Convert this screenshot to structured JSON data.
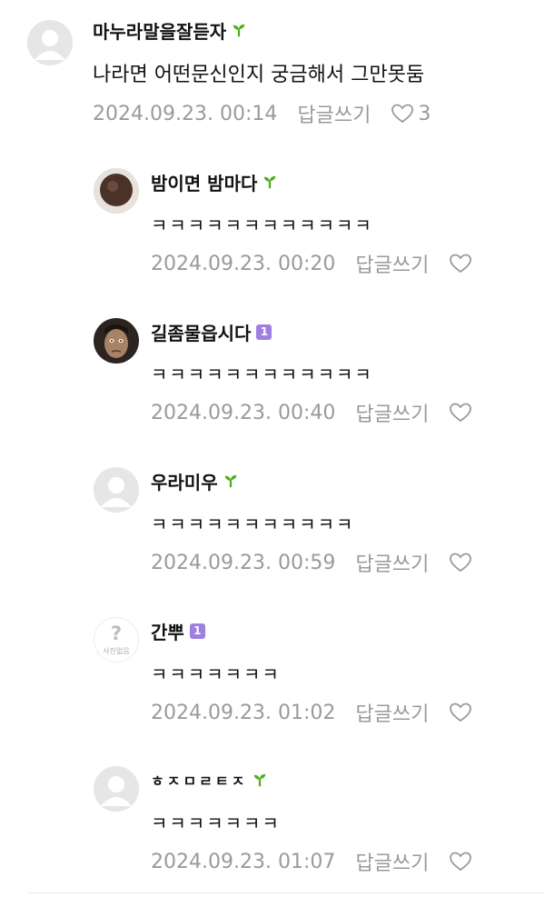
{
  "comments": [
    {
      "name": "마누라말을잘듣자",
      "badge": "sprout",
      "text": "나라면 어떤문신인지 궁금해서 그만못둠",
      "date": "2024.09.23. 00:14",
      "reply": "답글쓰기",
      "likes": "3",
      "avatar": "default-avatar"
    },
    {
      "name": "밤이면 밤마다",
      "badge": "sprout",
      "text": "ㅋㅋㅋㅋㅋㅋㅋㅋㅋㅋㅋㅋ",
      "date": "2024.09.23. 00:20",
      "reply": "답글쓰기",
      "avatar": "photo-avatar"
    },
    {
      "name": "길좀물읍시다",
      "badge": "level",
      "badge_text": "1",
      "text": "ㅋㅋㅋㅋㅋㅋㅋㅋㅋㅋㅋㅋ",
      "date": "2024.09.23. 00:40",
      "reply": "답글쓰기",
      "avatar": "face-photo-avatar"
    },
    {
      "name": "우라미우",
      "badge": "sprout",
      "text": "ㅋㅋㅋㅋㅋㅋㅋㅋㅋㅋㅋ",
      "date": "2024.09.23. 00:59",
      "reply": "답글쓰기",
      "avatar": "default-avatar"
    },
    {
      "name": "간뿌",
      "badge": "level",
      "badge_text": "1",
      "text": "ㅋㅋㅋㅋㅋㅋㅋ",
      "date": "2024.09.23. 01:02",
      "reply": "답글쓰기",
      "avatar": "no-photo-avatar",
      "avatar_caption": "사진없음"
    },
    {
      "name": "ㅎㅈㅁㄹㅌㅈ",
      "badge": "sprout",
      "text": "ㅋㅋㅋㅋㅋㅋㅋ",
      "date": "2024.09.23. 01:07",
      "reply": "답글쓰기",
      "avatar": "default-avatar"
    }
  ],
  "colors": {
    "meta": "#9a9a9a",
    "sprout": "#4caf1e",
    "level_badge": "#9f7fe0"
  }
}
